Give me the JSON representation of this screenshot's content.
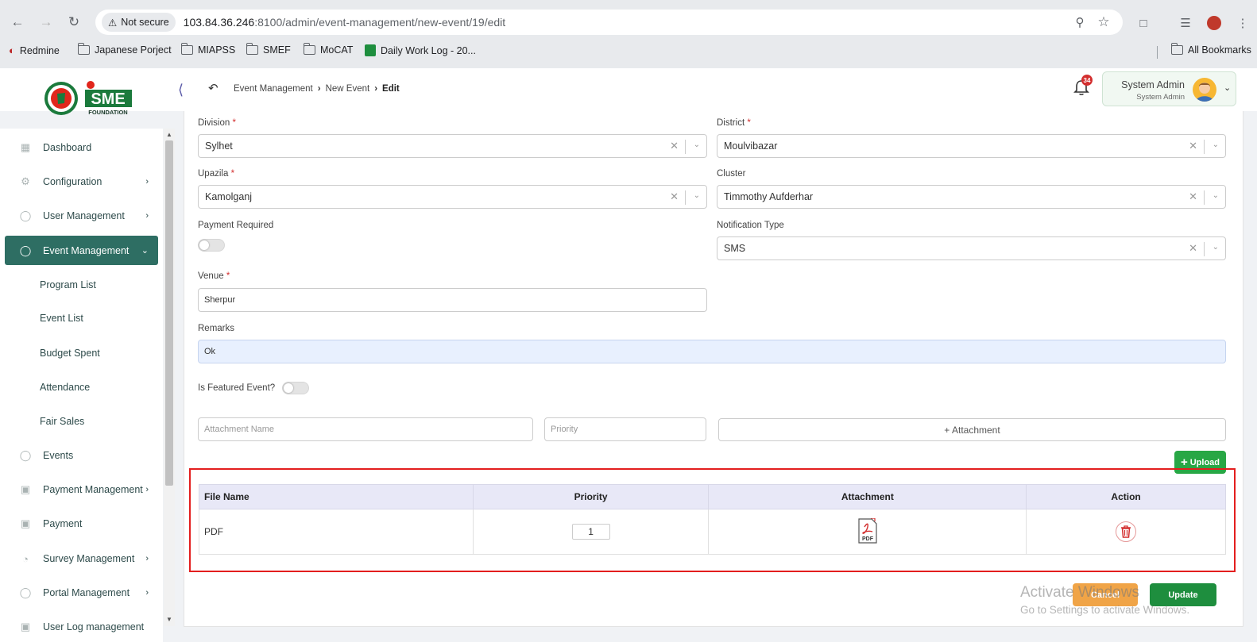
{
  "browser": {
    "security_label": "Not secure",
    "url_host": "103.84.36.246",
    "url_rest": ":8100/admin/event-management/new-event/19/edit",
    "bookmarks": [
      "Redmine",
      "Japanese Porject",
      "MIAPSS",
      "SMEF",
      "MoCAT",
      "Daily Work Log - 20...",
      "All Bookmarks"
    ]
  },
  "header": {
    "breadcrumb": [
      "Event Management",
      "New Event",
      "Edit"
    ],
    "notification_count": "34",
    "user_name": "System Admin",
    "user_role": "System Admin",
    "logo_text": "SME",
    "logo_subtext": "FOUNDATION"
  },
  "sidebar": {
    "items": [
      {
        "label": "Dashboard"
      },
      {
        "label": "Configuration"
      },
      {
        "label": "User Management"
      },
      {
        "label": "Event Management"
      },
      {
        "label": "Events"
      },
      {
        "label": "Payment Management"
      },
      {
        "label": "Payment"
      },
      {
        "label": "Survey Management"
      },
      {
        "label": "Portal Management"
      },
      {
        "label": "User Log management"
      }
    ],
    "sub_items": [
      "Program List",
      "Event List",
      "Budget Spent",
      "Attendance",
      "Fair Sales"
    ]
  },
  "form": {
    "division": {
      "label": "Division",
      "value": "Sylhet"
    },
    "district": {
      "label": "District",
      "value": "Moulvibazar"
    },
    "upazila": {
      "label": "Upazila",
      "value": "Kamolganj"
    },
    "cluster": {
      "label": "Cluster",
      "value": "Timmothy Aufderhar"
    },
    "payment_required": {
      "label": "Payment Required"
    },
    "notification_type": {
      "label": "Notification Type",
      "value": "SMS"
    },
    "venue": {
      "label": "Venue",
      "value": "Sherpur"
    },
    "remarks": {
      "label": "Remarks",
      "value": "Ok"
    },
    "featured": {
      "label": "Is Featured Event?"
    },
    "attachment_name_placeholder": "Attachment Name",
    "priority_placeholder": "Priority",
    "add_attachment_label": "+ Attachment",
    "upload_label": "Upload",
    "required_mark": "*"
  },
  "table": {
    "headers": [
      "File Name",
      "Priority",
      "Attachment",
      "Action"
    ],
    "rows": [
      {
        "file_name": "PDF",
        "priority": "1"
      }
    ]
  },
  "actions": {
    "cancel": "Cancel",
    "update": "Update"
  },
  "watermark": {
    "line1": "Activate Windows",
    "line2": "Go to Settings to activate Windows."
  },
  "colors": {
    "primary": "#2e6e63",
    "success": "#28a745",
    "warning": "#f0a447",
    "danger": "#d32f2f",
    "highlight": "#e31e1e"
  }
}
